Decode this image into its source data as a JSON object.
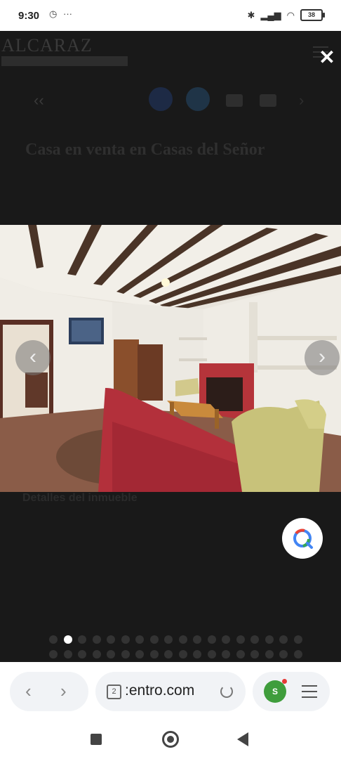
{
  "status_bar": {
    "time": "9:30",
    "left_icons": [
      "clock-icon",
      "more-dots-icon"
    ],
    "right_icons": [
      "bluetooth-icon",
      "signal-icon",
      "wifi-icon",
      "battery-icon"
    ],
    "battery_level": "38"
  },
  "background_page": {
    "logo_text": "ALCARAZ",
    "share_icons": [
      "facebook-icon",
      "twitter-icon",
      "email-icon",
      "print-icon",
      "chevron-right-icon"
    ],
    "title": "Casa en venta en Casas del Señor",
    "subtitle": "",
    "price": "",
    "details_heading": "Detalles del inmueble",
    "detail_rows": [
      {
        "label": "",
        "value": ""
      },
      {
        "label": "",
        "value": ""
      },
      {
        "label": "",
        "value": ""
      }
    ]
  },
  "viewer": {
    "close_label": "✕",
    "prev_label": "‹",
    "next_label": "›",
    "photo_count": 18,
    "active_index": 0
  },
  "browser": {
    "back_label": "‹",
    "forward_label": "›",
    "tab_count": "2",
    "url": ":entro.com",
    "extension_label": "S"
  },
  "colors": {
    "overlay": "#191919",
    "lens_blue": "#4285f4",
    "sofa_red": "#b3303b",
    "armchair_green": "#c8c27a"
  }
}
